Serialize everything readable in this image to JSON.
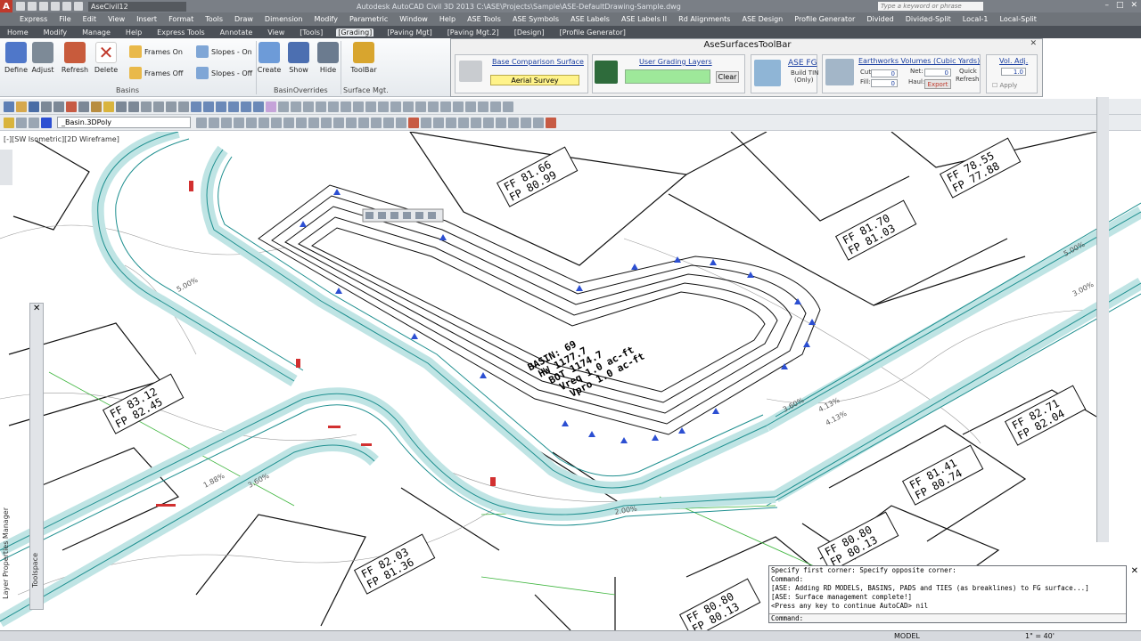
{
  "titlebar": {
    "app_letter": "A",
    "workspace": "AseCivil12",
    "title": "Autodesk AutoCAD Civil 3D 2013    C:\\ASE\\Projects\\Sample\\ASE-DefaultDrawing-Sample.dwg",
    "search_placeholder": "Type a keyword or phrase",
    "controls": [
      "–",
      "□",
      "✕"
    ]
  },
  "menubar": [
    "Express",
    "File",
    "Edit",
    "View",
    "Insert",
    "Format",
    "Tools",
    "Draw",
    "Dimension",
    "Modify",
    "Parametric",
    "Window",
    "Help",
    "ASE Tools",
    "ASE Symbols",
    "ASE Labels",
    "ASE Labels II",
    "Rd Alignments",
    "ASE Design",
    "Profile Generator",
    "Divided",
    "Divided-Split",
    "Local-1",
    "Local-Split"
  ],
  "ribbontabs": [
    "Home",
    "Modify",
    "Manage",
    "Help",
    "Express Tools",
    "Annotate",
    "View",
    "[Tools]",
    "[Grading]",
    "[Paving Mgt]",
    "[Paving Mgt.2]",
    "[Design]",
    "[Profile Generator]"
  ],
  "ribbontabs_active": "[Grading]",
  "ribbon": {
    "buttons": [
      {
        "label": "Define",
        "color": "#4f77c9"
      },
      {
        "label": "Adjust",
        "color": "#7d8a97"
      },
      {
        "label": "Refresh",
        "color": "#c85b3c"
      },
      {
        "label": "Delete",
        "color": "#c0392b"
      },
      {
        "label": "Create",
        "color": "#6d9bd8"
      },
      {
        "label": "Show",
        "color": "#4c6fb1"
      },
      {
        "label": "Hide",
        "color": "#6b7b8f"
      },
      {
        "label": "ToolBar",
        "color": "#d8a52e"
      }
    ],
    "small": [
      "Frames On",
      "Frames Off",
      "Slopes - On",
      "Slopes - Off"
    ],
    "panels": [
      "Basins",
      "BasinOverrides",
      "Surface Mgt."
    ]
  },
  "asetb": {
    "title": "AseSurfacesToolBar",
    "base_link": "Base Comparison Surface",
    "base_value": "Aerial Survey",
    "user_link": "User Grading Layers",
    "clear": "Clear",
    "asefg": "ASE FG",
    "build_tin": "Build TIN",
    "only": "(Only)",
    "earthworks": "Earthworks Volumes (Cubic Yards)",
    "cut_label": "Cut:",
    "fill_label": "Fill:",
    "cut_value": "0",
    "fill_value": "0",
    "net_label": "Net:",
    "haul_label": "Haul:",
    "net_value": "0",
    "haul_value": "0",
    "export": "Export",
    "quick": "Quick",
    "refresh": "Refresh",
    "voladj": "Vol. Adj.",
    "voladj_value": "1.0",
    "apply": "Apply"
  },
  "toolbar2": {
    "layer": "_Basin.3DPoly"
  },
  "viewlabel": "[-][SW Isometric][2D Wireframe]",
  "drawing": {
    "ff_labels": [
      {
        "ff": "FF 81.66",
        "fp": "FP 80.99"
      },
      {
        "ff": "FF 78.55",
        "fp": "FP 77.88"
      },
      {
        "ff": "FF 81.70",
        "fp": "FP 81.03"
      },
      {
        "ff": "FF 83.12",
        "fp": "FP 82.45"
      },
      {
        "ff": "FF 82.71",
        "fp": "FP 82.04"
      },
      {
        "ff": "FF 81.41",
        "fp": "FP 80.74"
      },
      {
        "ff": "FF 80.80",
        "fp": "FP 80.13"
      },
      {
        "ff": "FF 82.03",
        "fp": "FP 81.36"
      },
      {
        "ff": "FF 80.80",
        "fp": "FP 80.13"
      }
    ],
    "basin_text": [
      "BASIN: 69",
      "HW  1177.7",
      "BOT 1174.7",
      "Vreq 1.0 ac-ft",
      "Vpro 1.0 ac-ft"
    ],
    "slope_labels": [
      "3.00%",
      "5.00%",
      "4.13%",
      "4.13%",
      "3.60%",
      "2.00%",
      "5.00%",
      "1.88%",
      "3.60%"
    ]
  },
  "leftpal": {
    "label": "Toolspace"
  },
  "leftlabel": "Layer Properties Manager",
  "cmd": {
    "lines": [
      "Specify first corner: Specify opposite corner:",
      "Command:",
      "[ASE: Adding RD MODELS, BASINS, PADS and TIES (as breaklines) to FG surface...]",
      "[ASE: Surface management  complete!]",
      "<Press any key to continue AutoCAD> nil"
    ],
    "prompt": "Command:"
  },
  "statusbar": {
    "model": "MODEL",
    "scale": "1\" = 40'"
  },
  "colors": {
    "road": "#2aa3a3",
    "contour": "#222222",
    "accent": "#c0392b",
    "blue_marker": "#2c4fd2"
  }
}
